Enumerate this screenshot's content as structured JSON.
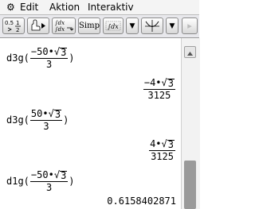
{
  "menu": {
    "gear_glyph": "⚙",
    "items": [
      "Edit",
      "Aktion",
      "Interaktiv"
    ]
  },
  "toolbar": {
    "buttons": [
      {
        "name": "fraction-decimal-toggle",
        "label": "0.5 ½"
      },
      {
        "name": "hand-run",
        "label": "▶"
      },
      {
        "name": "derivative-template",
        "label": "fdx fdx"
      },
      {
        "name": "simp",
        "label": "Simp"
      },
      {
        "name": "integral-template",
        "label": "∫dx"
      },
      {
        "name": "dropdown-1",
        "label": "▼"
      },
      {
        "name": "graph-window",
        "label": ""
      },
      {
        "name": "dropdown-2",
        "label": "▼"
      },
      {
        "name": "scroll-right",
        "label": "▸"
      }
    ]
  },
  "entries": [
    {
      "func": "d3g(",
      "num_sign": "−",
      "num_coef": "50",
      "radicand": "3",
      "den": "3",
      "close": ")",
      "result": {
        "num_coef": "−4",
        "radicand": "3",
        "den": "3125"
      }
    },
    {
      "func": "d3g(",
      "num_sign": "",
      "num_coef": "50",
      "radicand": "3",
      "den": "3",
      "close": ")",
      "result": {
        "num_coef": "4",
        "radicand": "3",
        "den": "3125"
      }
    },
    {
      "func": "d1g(",
      "num_sign": "−",
      "num_coef": "50",
      "radicand": "3",
      "den": "3",
      "close": ")",
      "result_decimal": "0.6158402871"
    }
  ],
  "dot": "•",
  "radical": "√"
}
